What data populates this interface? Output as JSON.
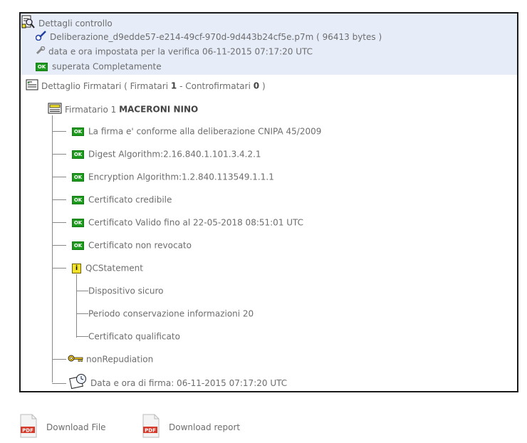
{
  "header": {
    "title": "Dettagli controllo",
    "file_name": "Deliberazione_d9edde57-e214-49cf-970d-9d443b24cf5e.p7m",
    "file_size": "( 96413 bytes )",
    "verification_date": "data e ora impostata per la verifica 06-11-2015 07:17:20 UTC",
    "status": "superata Completamente"
  },
  "signers_section": {
    "label_prefix": "Dettaglio Firmatari ( Firmatari",
    "signers_count": "1",
    "label_mid": "- Controfirmatari",
    "countersigners_count": "0",
    "label_suffix": ")"
  },
  "signer": {
    "label": "Firmatario 1",
    "name": "MACERONI NINO",
    "checks": [
      "La firma e' conforme alla deliberazione CNIPA 45/2009",
      "Digest Algorithm:2.16.840.1.101.3.4.2.1",
      "Encryption Algorithm:1.2.840.113549.1.1.1",
      "Certificato credibile",
      "Certificato Valido fino al 22-05-2018 08:51:01 UTC",
      "Certificato non revocato"
    ],
    "qc_label": "QCStatement",
    "qc_items": [
      "Dispositivo sicuro",
      "Periodo conservazione informazioni 20",
      "Certificato qualificato"
    ],
    "key_usage": "nonRepudiation",
    "signing_time": "Data e ora di firma: 06-11-2015 07:17:20 UTC"
  },
  "ok_badge": "OK",
  "info_badge": "i",
  "downloads": {
    "file_label": "Download File",
    "report_label": "Download report",
    "pdf_badge": "PDF"
  }
}
